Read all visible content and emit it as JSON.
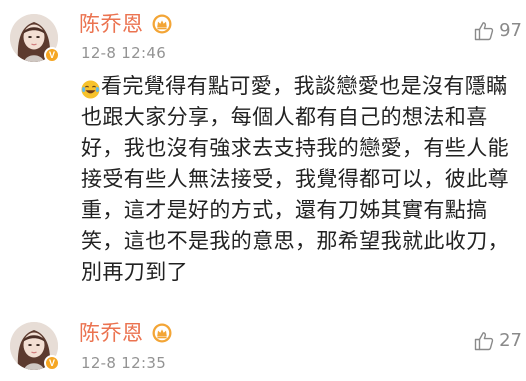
{
  "comments": [
    {
      "username": "陈乔恩",
      "timestamp": "12-8 12:46",
      "likes": "97",
      "lines": [
        "看完覺得有點可愛，我談戀愛也是沒有隱瞞",
        "也跟大家分享，每個人都有自己的想法和喜",
        "好，我也沒有強求去支持我的戀愛，有些人能",
        "接受有些人無法接受，我覺得都可以，彼此尊",
        "重，這才是好的方式，還有刀姊其實有點搞",
        "笑，這也不是我的意思，那希望我就此收刀，",
        "別再刀到了"
      ]
    },
    {
      "username": "陈乔恩",
      "timestamp": "12-8 12:35",
      "likes": "27"
    }
  ],
  "icons": {
    "verified": "verified-badge-icon",
    "vip": "vip-crown-icon",
    "like": "thumbs-up-icon",
    "emoji": "laughing-tears-emoji-icon"
  },
  "colors": {
    "username": "#eb7350",
    "timestamp": "#939393",
    "text": "#222222",
    "like": "#8a8a8a",
    "verified_badge": "#f5a623",
    "vip_badge": "#f3a536"
  }
}
